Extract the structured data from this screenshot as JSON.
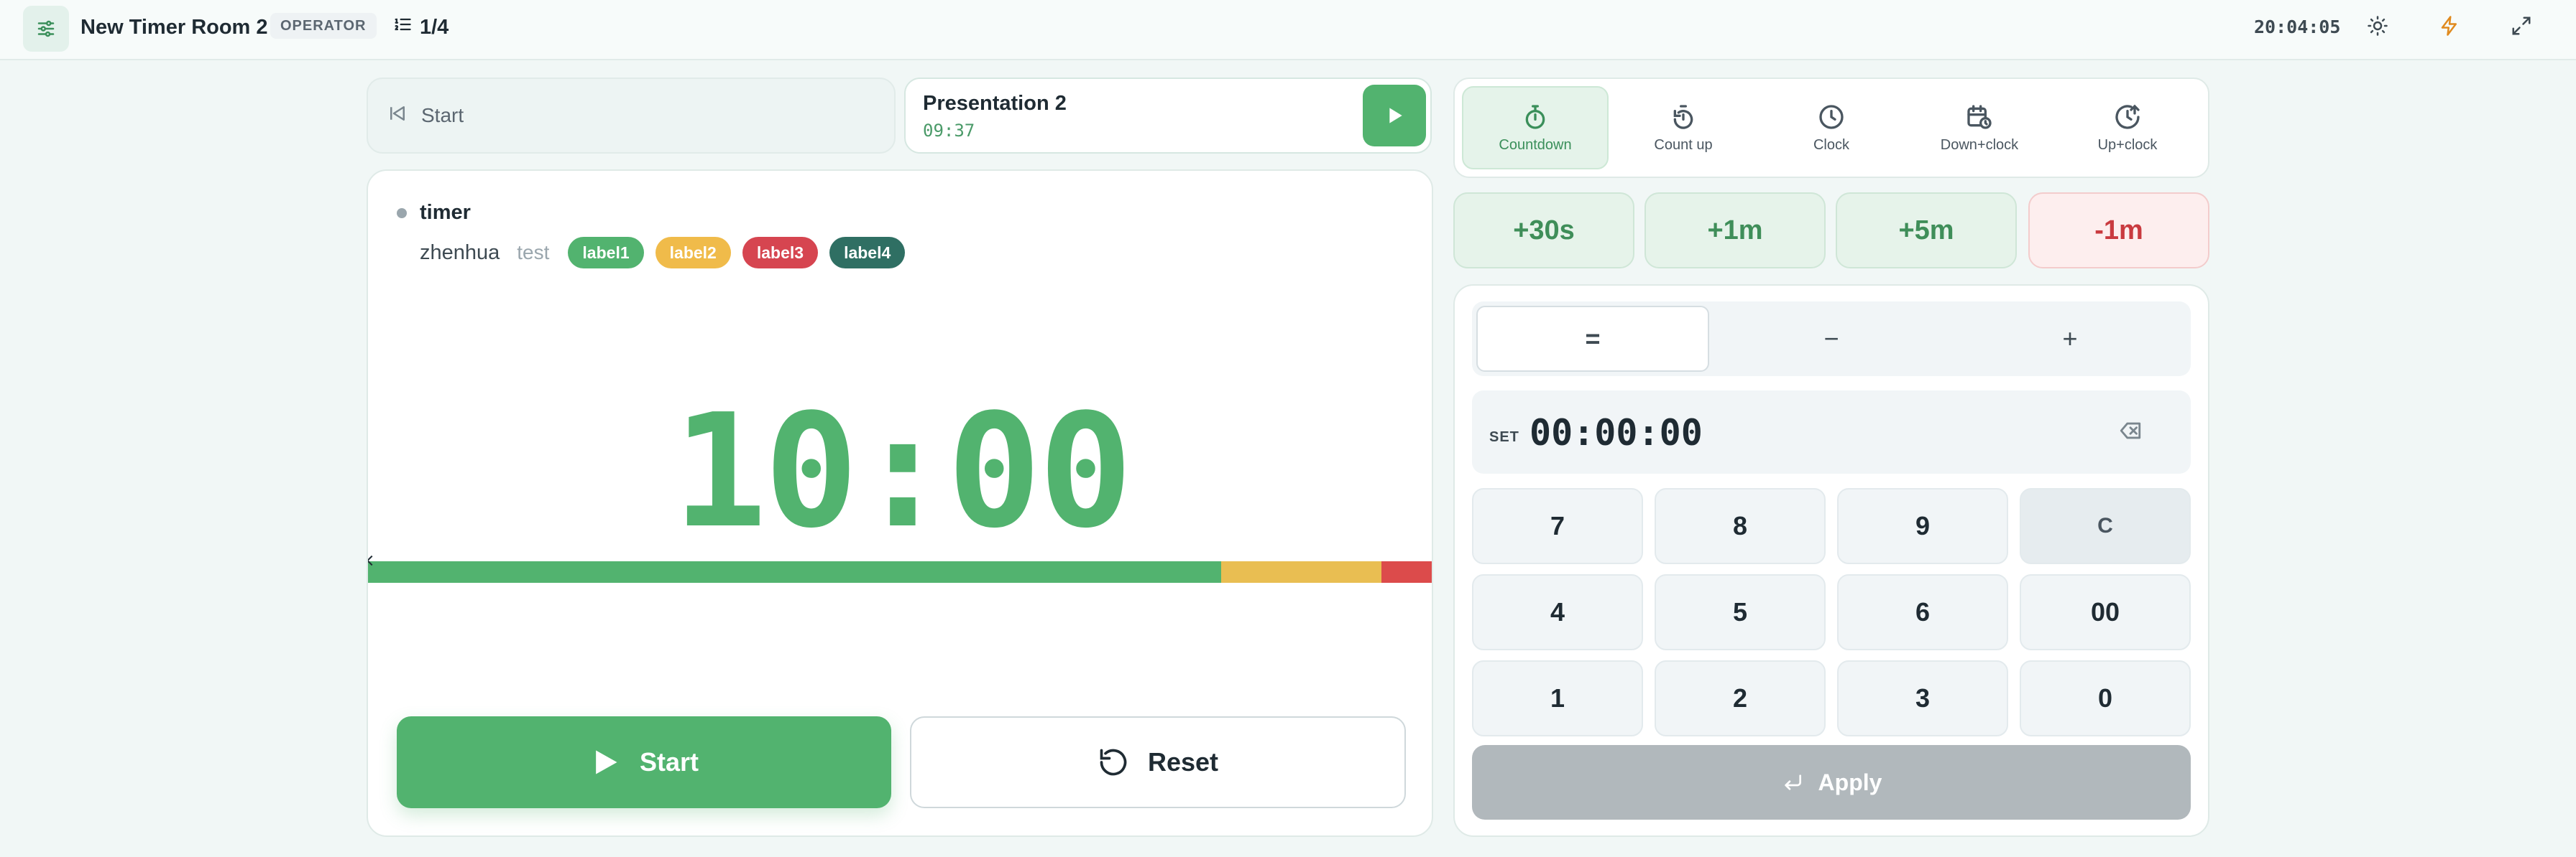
{
  "header": {
    "room_title": "New Timer Room 2",
    "role_badge": "OPERATOR",
    "position_counter": "1/4",
    "clock": "20:04:05",
    "icons": [
      "sliders-icon",
      "list-ordered-icon",
      "sun-icon",
      "bolt-icon",
      "expand-icon"
    ]
  },
  "navigation": {
    "prev_label": "Start",
    "next": {
      "title": "Presentation 2",
      "duration": "09:37"
    }
  },
  "timer": {
    "name": "timer",
    "speaker": "zhenhua",
    "notes": "test",
    "labels": [
      {
        "text": "label1",
        "color": "#52b36f"
      },
      {
        "text": "label2",
        "color": "#f0bb4a"
      },
      {
        "text": "label3",
        "color": "#d64550"
      },
      {
        "text": "label4",
        "color": "#2f6f63"
      }
    ],
    "display": "10:00",
    "progress": {
      "green": 0.8,
      "yellow": 0.15,
      "red": 0.05
    },
    "colors": {
      "green": "#52b36f",
      "yellow": "#e9be52",
      "red": "#dc4b4b"
    }
  },
  "controls": {
    "start_label": "Start",
    "reset_label": "Reset"
  },
  "modes": [
    {
      "label": "Countdown",
      "icon": "stopwatch-icon",
      "active": true
    },
    {
      "label": "Count up",
      "icon": "timer-up-icon",
      "active": false
    },
    {
      "label": "Clock",
      "icon": "clock-icon",
      "active": false
    },
    {
      "label": "Down+clock",
      "icon": "calendar-clock-icon",
      "active": false
    },
    {
      "label": "Up+clock",
      "icon": "clock-up-icon",
      "active": false
    }
  ],
  "adjust": [
    "+30s",
    "+1m",
    "+5m",
    "-1m"
  ],
  "keypad": {
    "ops": [
      "=",
      "−",
      "+"
    ],
    "set_label": "SET",
    "set_value": "00:00:00",
    "keys": [
      "7",
      "8",
      "9",
      "C",
      "4",
      "5",
      "6",
      "00",
      "1",
      "2",
      "3",
      "0"
    ],
    "apply_label": "Apply"
  }
}
